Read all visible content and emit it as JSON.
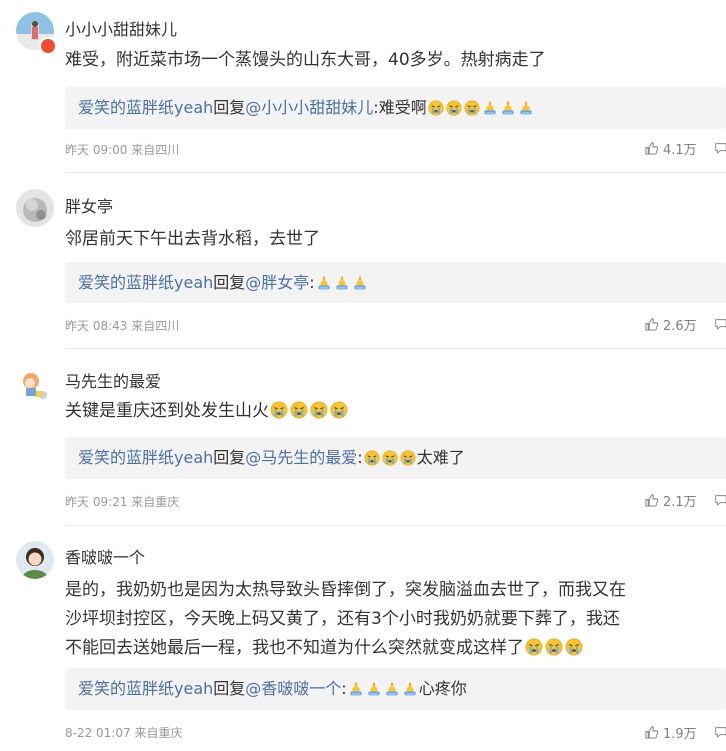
{
  "comments": [
    {
      "username": "小小小甜甜妹儿",
      "content": "难受，附近菜市场一个蒸馒头的山东大哥，40多岁。热射病走了",
      "reply": {
        "user": "爱笑的蓝胖纸yeah",
        "verb": "回复",
        "target": "@小小小甜甜妹儿",
        "colon": ":",
        "text_before": "难受啊",
        "text_after": ""
      },
      "time": "昨天 09:00",
      "source": "来自四川",
      "likes": "4.1万"
    },
    {
      "username": "胖女亭",
      "content": "邻居前天下午出去背水稻，去世了",
      "reply": {
        "user": "爱笑的蓝胖纸yeah",
        "verb": "回复",
        "target": "@胖女亭",
        "colon": ":",
        "text_before": "",
        "text_after": ""
      },
      "time": "昨天 08:43",
      "source": "来自四川",
      "likes": "2.6万"
    },
    {
      "username": "马先生的最爱",
      "content": "关键是重庆还到处发生山火",
      "reply": {
        "user": "爱笑的蓝胖纸yeah",
        "verb": "回复",
        "target": "@马先生的最爱",
        "colon": ":",
        "text_before": "",
        "text_after": "太难了"
      },
      "time": "昨天 09:21",
      "source": "来自重庆",
      "likes": "2.1万"
    },
    {
      "username": "香啵啵一个",
      "content_lines": [
        "是的，我奶奶也是因为太热导致头昏摔倒了，突发脑溢血去世了，而我又在",
        "沙坪坝封控区，今天晚上码又黄了，还有3个小时我奶奶就要下葬了，我还",
        "不能回去送她最后一程，我也不知道为什么突然就变成这样了"
      ],
      "reply": {
        "user": "爱笑的蓝胖纸yeah",
        "verb": "回复",
        "target": "@香啵啵一个",
        "colon": ":",
        "text_before": "",
        "text_after": "心疼你"
      },
      "time": "8-22 01:07",
      "source": "来自重庆",
      "likes": "1.9万"
    }
  ],
  "icons": {
    "like": "thumbs-up-icon",
    "comment": "comment-bubble-icon",
    "cry": "crying-face-emoji",
    "candle": "candle-prayer-emoji"
  },
  "colors": {
    "link": "#4d6fa3",
    "meta": "#999999",
    "reply_bg": "#f3f3f3"
  }
}
